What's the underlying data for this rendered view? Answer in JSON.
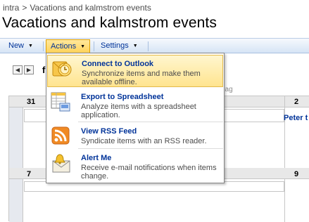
{
  "breadcrumb": {
    "site": "intra",
    "separator": ">",
    "current": "Vacations and kalmstrom events"
  },
  "page": {
    "title": "Vacations and kalmstrom events"
  },
  "toolbar": {
    "new_label": "New",
    "actions_label": "Actions",
    "settings_label": "Settings"
  },
  "calendar": {
    "month_initial": "f",
    "weekday_fragment": "dag",
    "prev_icon": "arrow-left-icon",
    "next_icon": "arrow-right-icon",
    "row1": {
      "first": "31",
      "last": "2"
    },
    "row2": {
      "first": "7",
      "last": "9"
    },
    "event": "Peter t"
  },
  "actions_menu": {
    "items": [
      {
        "title": "Connect to Outlook",
        "description": "Synchronize items and make them available offline.",
        "icon": "outlook-icon"
      },
      {
        "title": "Export to Spreadsheet",
        "description": "Analyze items with a spreadsheet application.",
        "icon": "spreadsheet-icon"
      },
      {
        "title": "View RSS Feed",
        "description": "Syndicate items with an RSS reader.",
        "icon": "rss-icon"
      },
      {
        "title": "Alert Me",
        "description": "Receive e-mail notifications when items change.",
        "icon": "alert-bell-icon"
      }
    ]
  },
  "colors": {
    "link": "#003399",
    "highlight": "#ffe48f",
    "toolbar": "#d6e4f5"
  }
}
